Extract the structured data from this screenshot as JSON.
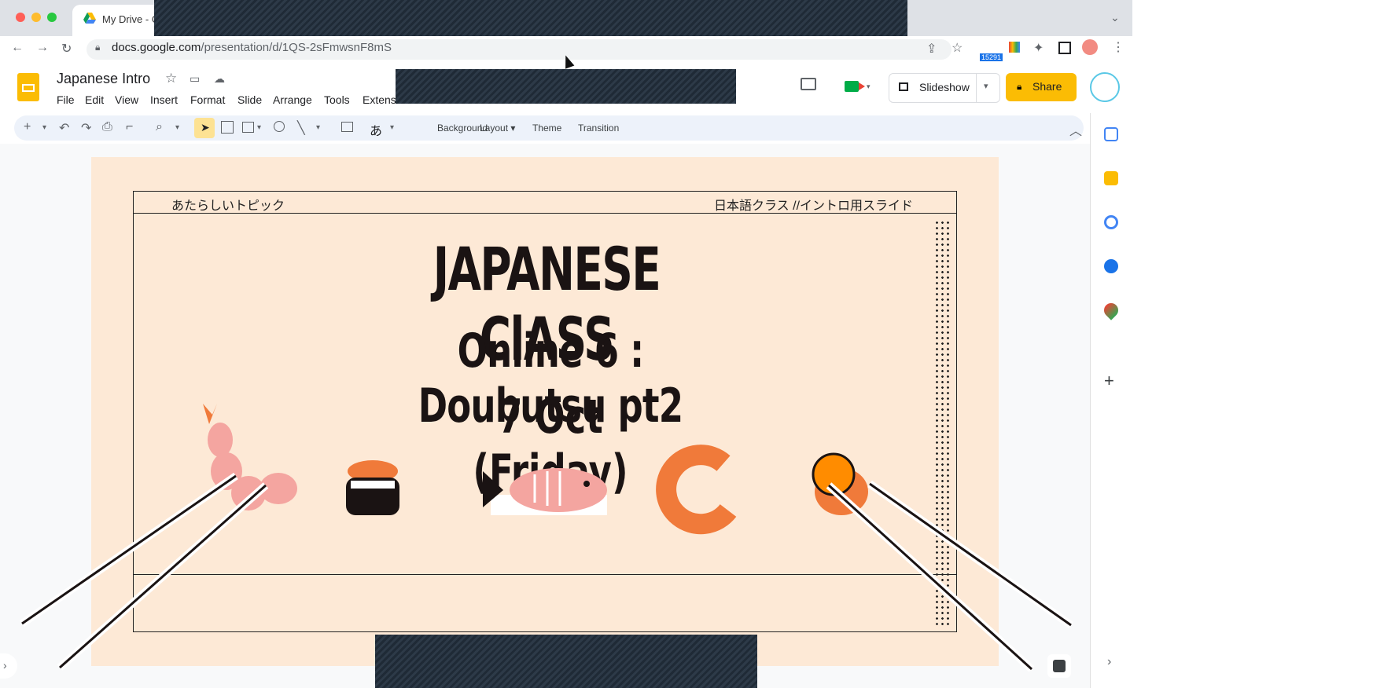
{
  "browser": {
    "tab_title": "My Drive - G",
    "url_host": "docs.google.com",
    "url_path": "/presentation/d/1QS-2sFmwsnF8mS",
    "badge_count": "15291"
  },
  "app": {
    "doc_title": "Japanese Intro",
    "menu": [
      "File",
      "Edit",
      "View",
      "Insert",
      "Format",
      "Slide",
      "Arrange",
      "Tools",
      "Extens"
    ],
    "slideshow_label": "Slideshow",
    "share_label": "Share"
  },
  "toolbar": {
    "background_label": "Background",
    "layout_label": "Layout",
    "theme_label": "Theme",
    "transition_label": "Transition",
    "input_tool": "あ"
  },
  "slide": {
    "header_left": "あたらしいトピック",
    "header_right": "日本語クラス //イントロ用スライド",
    "title": "JAPANESE ClASS",
    "subtitle": "Online 6 : Doubutsu pt2",
    "date": "7 Oct (Friday)"
  },
  "colors": {
    "slide_bg": "#fde9d6",
    "share_yellow": "#fbbc04",
    "salmon": "#f4a5a0",
    "orange": "#f07a3a"
  }
}
